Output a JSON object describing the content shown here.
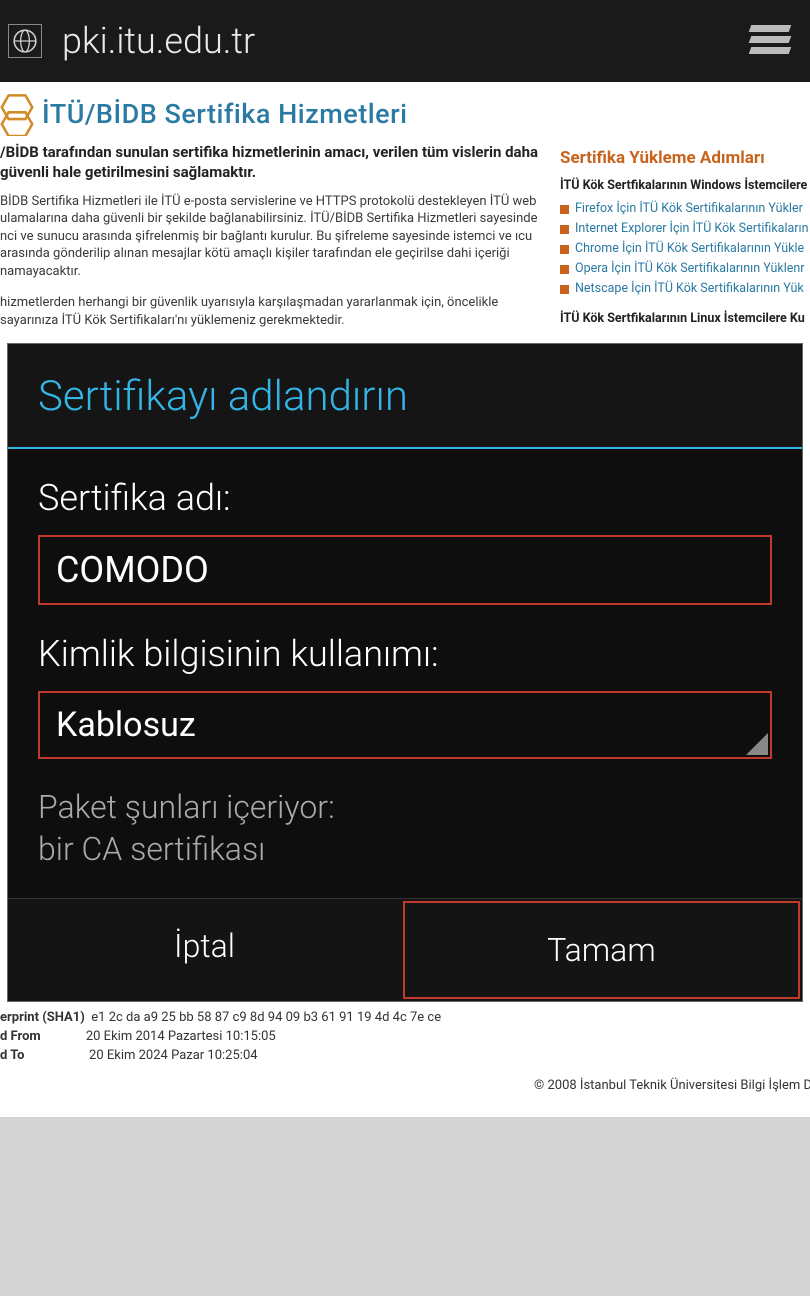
{
  "topbar": {
    "url": "pki.itu.edu.tr"
  },
  "logo_text": "İTÜ/BİDB Sertifika Hizmetleri",
  "intro_bold": "/BİDB tarafından sunulan sertifika hizmetlerinin amacı, verilen tüm vislerin daha güvenli hale getirilmesini sağlamaktır.",
  "intro_p1": "BİDB Sertifika Hizmetleri ile İTÜ e-posta servislerine ve HTTPS protokolü destekleyen İTÜ web ulamalarına daha güvenli bir şekilde bağlanabilirsiniz. İTÜ/BİDB Sertifika Hizmetleri sayesinde nci ve sunucu arasında şifrelenmiş bir bağlantı kurulur. Bu şifreleme sayesinde istemci ve ıcu arasında gönderilip alınan mesajlar kötü amaçlı kişiler tarafından ele geçirilse dahi içeriği namayacaktır.",
  "intro_p2": "hizmetlerden herhangi bir güvenlik uyarısıyla karşılaşmadan yararlanmak için, öncelikle sayarınıza İTÜ Kök Sertifikaları'nı yüklemeniz gerekmektedir.",
  "right": {
    "title": "Sertifika Yükleme Adımları",
    "sub_windows": "İTÜ Kök Sertfikalarının Windows İstemcilere",
    "links_win": [
      "Firefox İçin İTÜ Kök Sertifikalarının Yükler",
      "Internet Explorer İçin İTÜ Kök Sertifikaların",
      "Chrome İçin İTÜ Kök Sertifikalarının Yükle",
      "Opera İçin İTÜ Kök Sertifikalarının Yüklenr",
      "Netscape İçin İTÜ Kök Sertifikalarının Yük"
    ],
    "sub_linux": "İTÜ Kök Sertfikalarının Linux İstemcilere Ku"
  },
  "fingerprint": {
    "lbl_sha1": "erprint (SHA1)",
    "sha1": "e1 2c da a9 25 bb 58 87 c9 8d 94 09 b3 61 91 19 4d 4c 7e ce",
    "lbl_from": "d From",
    "from": "20 Ekim 2014 Pazartesi 10:15:05",
    "lbl_to": "d To",
    "to": "20 Ekim 2024 Pazar 10:25:04"
  },
  "footer": "© 2008 İstanbul Teknik Üniversitesi Bilgi İşlem D",
  "dialog": {
    "title": "Sertifikayı adlandırın",
    "name_label": "Sertifika adı:",
    "name_value": "COMODO",
    "usage_label": "Kimlik bilgisinin kullanımı:",
    "usage_value": "Kablosuz",
    "package_heading": "Paket şunları içeriyor:",
    "package_item": "bir CA sertifikası",
    "cancel": "İptal",
    "ok": "Tamam"
  }
}
